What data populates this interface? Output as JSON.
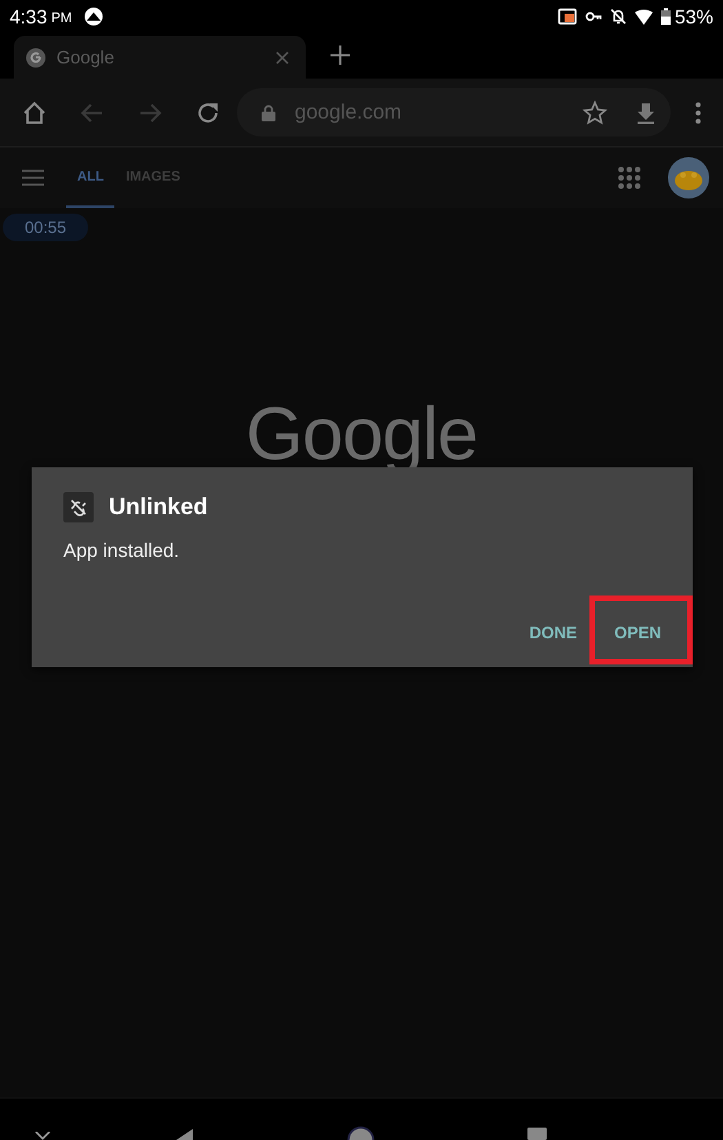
{
  "status_bar": {
    "time": "4:33",
    "meridiem": "PM",
    "battery": "53%"
  },
  "browser_tab": {
    "title": "Google"
  },
  "address_bar": {
    "url": "google.com"
  },
  "search_tabs": [
    {
      "label": "ALL",
      "selected": true
    },
    {
      "label": "IMAGES",
      "selected": false
    }
  ],
  "timer": "00:55",
  "logo": "Google",
  "dialog": {
    "title": "Unlinked",
    "message": "App installed.",
    "buttons": [
      {
        "label": "DONE",
        "highlighted": false
      },
      {
        "label": "OPEN",
        "highlighted": true
      }
    ]
  }
}
